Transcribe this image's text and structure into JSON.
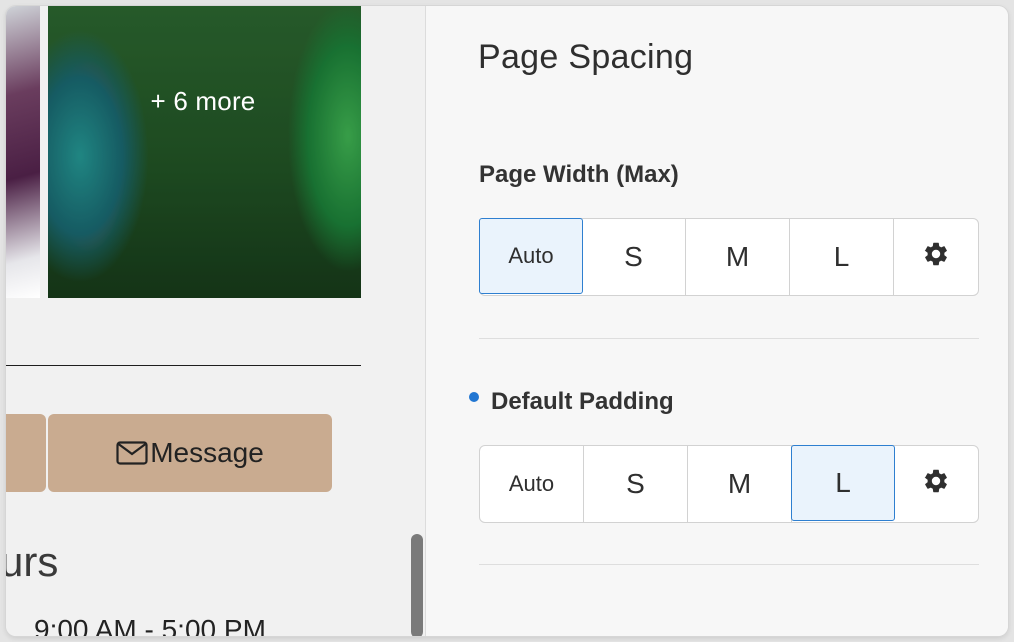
{
  "preview": {
    "gallery": {
      "more_label": "+ 6 more"
    },
    "message_button": {
      "label": "Message",
      "icon": "envelope-icon",
      "color": "#c9ab90"
    },
    "hours": {
      "heading": "urs",
      "row_time": "9:00 AM - 5:00 PM"
    }
  },
  "panel": {
    "title": "Page Spacing",
    "page_width": {
      "label": "Page Width (Max)",
      "options": [
        "Auto",
        "S",
        "M",
        "L"
      ],
      "settings_icon": "gear-icon",
      "selected": "Auto"
    },
    "default_padding": {
      "label": "Default Padding",
      "modified_indicator_color": "#2176d2",
      "options": [
        "Auto",
        "S",
        "M",
        "L"
      ],
      "settings_icon": "gear-icon",
      "selected": "L"
    },
    "accent_color": "#2e7fd0"
  }
}
